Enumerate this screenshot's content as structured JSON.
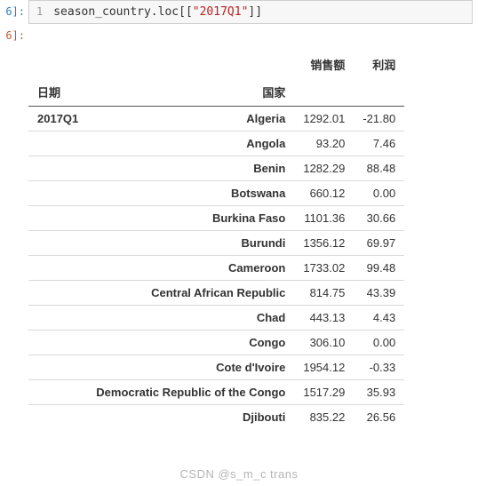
{
  "prompt_in_suffix": "6]:",
  "prompt_out_suffix": "6]:",
  "code": {
    "line_number": "1",
    "before_string": "season_country.loc[[",
    "string_literal": "\"2017Q1\"",
    "after_string": "]]"
  },
  "table": {
    "columns": [
      "销售额",
      "利润"
    ],
    "index_names": [
      "日期",
      "国家"
    ],
    "date_index": "2017Q1",
    "rows": [
      {
        "country": "Algeria",
        "sales": "1292.01",
        "profit": "-21.80"
      },
      {
        "country": "Angola",
        "sales": "93.20",
        "profit": "7.46"
      },
      {
        "country": "Benin",
        "sales": "1282.29",
        "profit": "88.48"
      },
      {
        "country": "Botswana",
        "sales": "660.12",
        "profit": "0.00"
      },
      {
        "country": "Burkina Faso",
        "sales": "1101.36",
        "profit": "30.66"
      },
      {
        "country": "Burundi",
        "sales": "1356.12",
        "profit": "69.97"
      },
      {
        "country": "Cameroon",
        "sales": "1733.02",
        "profit": "99.48"
      },
      {
        "country": "Central African Republic",
        "sales": "814.75",
        "profit": "43.39"
      },
      {
        "country": "Chad",
        "sales": "443.13",
        "profit": "4.43"
      },
      {
        "country": "Congo",
        "sales": "306.10",
        "profit": "0.00"
      },
      {
        "country": "Cote d'Ivoire",
        "sales": "1954.12",
        "profit": "-0.33"
      },
      {
        "country": "Democratic Republic of the Congo",
        "sales": "1517.29",
        "profit": "35.93"
      },
      {
        "country": "Djibouti",
        "sales": "835.22",
        "profit": "26.56"
      }
    ]
  },
  "watermark": "CSDN @s_m_c trans"
}
